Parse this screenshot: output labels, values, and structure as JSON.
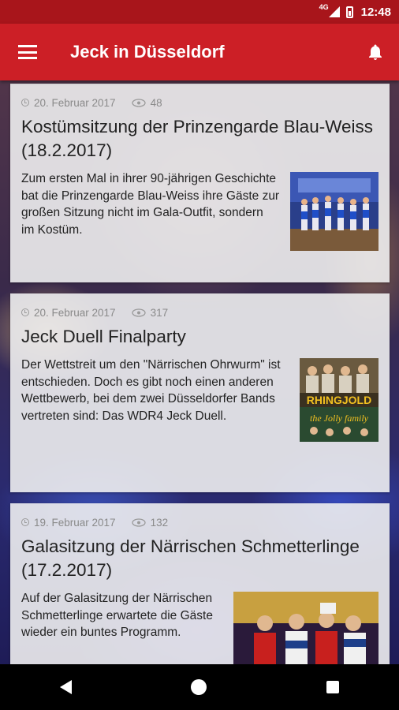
{
  "status_bar": {
    "network": "4G",
    "time": "12:48"
  },
  "app_bar": {
    "title": "Jeck in Düsseldorf",
    "menu_icon": "hamburger-menu-icon",
    "notification_icon": "bell-icon"
  },
  "articles": [
    {
      "date": "20. Februar 2017",
      "views": "48",
      "title": "Kostümsitzung der Prinzengarde Blau-Weiss (18.2.2017)",
      "text": "Zum ersten Mal in ihrer 90-jährigen Geschichte\nbat die Prinzengarde Blau-Weiss ihre Gäste zur großen Sitzung nicht im Gala-Outfit, sondern\nim Kostüm."
    },
    {
      "date": "20. Februar 2017",
      "views": "317",
      "title": "Jeck Duell Finalparty",
      "text": "Der Wettstreit um den \"Närrischen Ohrwurm\" ist entschieden. Doch es gibt noch einen anderen Wettbewerb, bei dem zwei Düsseldorfer Bands vertreten sind: Das WDR4 Jeck Duell."
    },
    {
      "date": "19. Februar 2017",
      "views": "132",
      "title": "Galasitzung der Närrischen Schmetterlinge (17.2.2017)",
      "text": "Auf der Galasitzung der Närrischen Schmetterlinge erwartete die Gäste wieder ein buntes Programm."
    }
  ],
  "thumb_logo_text": {
    "line1": "RHINGJOLD",
    "line2": "the Jolly family"
  },
  "colors": {
    "status_bar": "#a8151b",
    "app_bar": "#cc1f26",
    "card_bg": "#eeeef0"
  }
}
